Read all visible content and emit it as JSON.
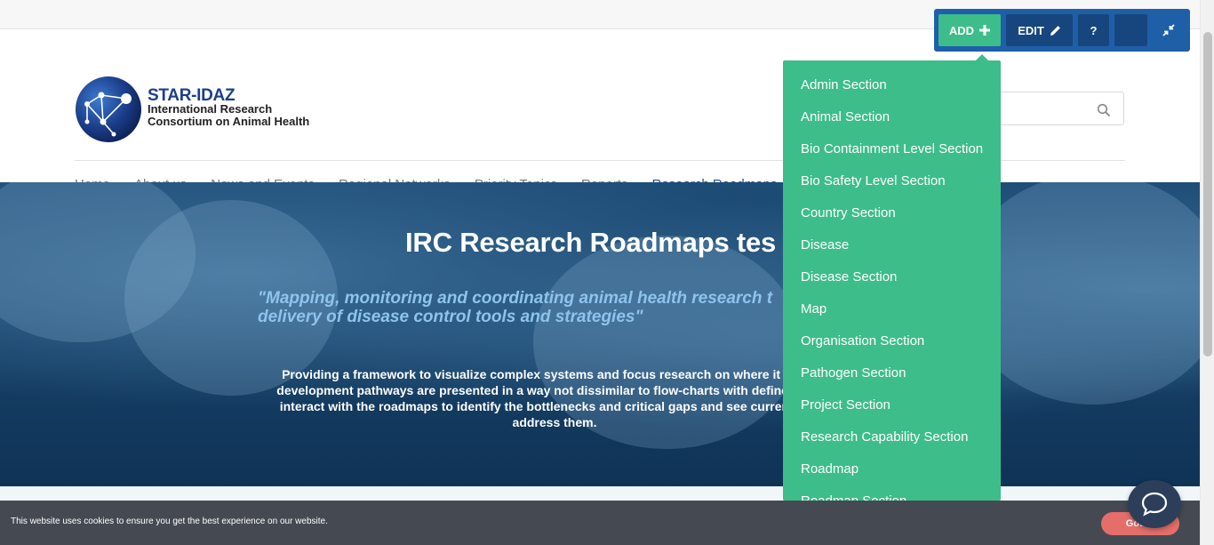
{
  "logo": {
    "name": "STAR-IDAZ",
    "subtitle": "International Research Consortium on Animal Health"
  },
  "search": {
    "placeholder": "",
    "icon": "search-icon"
  },
  "nav": {
    "items": [
      "Home",
      "About us",
      "News and Events",
      "Regional Networks",
      "Priority Topics",
      "Reports",
      "Research Roadmaps"
    ],
    "active": "Research Roadmaps"
  },
  "hero": {
    "title": "IRC Research Roadmaps tes",
    "quote": "\"Mapping, monitoring and coordinating animal health research t delivery of disease control tools and strategies\"",
    "text": "Providing a framework to visualize complex systems and focus research on where it is most development pathways are presented in a way not dissimilar to flow-charts with defined end p interact with the roadmaps to identify the bottlenecks and critical gaps and see current resea address them."
  },
  "admin_toolbar": {
    "add_label": "ADD",
    "edit_label": "EDIT",
    "help_label": "?",
    "accent": "#3dbd8a",
    "toolbar_bg": "#1f5fa8"
  },
  "add_menu": {
    "items": [
      "Admin Section",
      "Animal Section",
      "Bio Containment Level Section",
      "Bio Safety Level Section",
      "Country Section",
      "Disease",
      "Disease Section",
      "Map",
      "Organisation Section",
      "Pathogen Section",
      "Project Section",
      "Research Capability Section",
      "Roadmap",
      "Roadmap Section"
    ]
  },
  "cookie": {
    "message": "This website uses cookies to ensure you get the best experience on our website.",
    "button": "Got it!"
  }
}
